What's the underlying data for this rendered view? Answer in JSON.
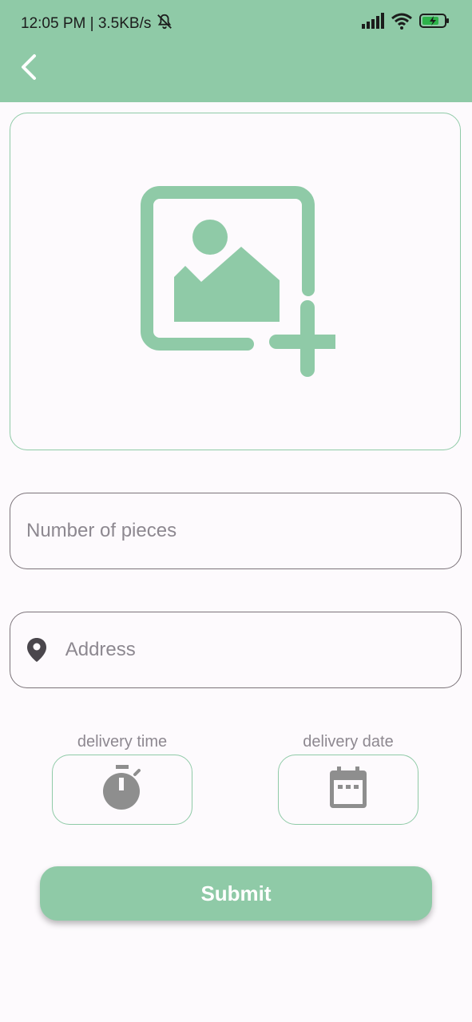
{
  "status_bar": {
    "time_speed": "12:05 PM | 3.5KB/s",
    "icons": [
      "bell-off-icon",
      "signal-icon",
      "wifi-icon",
      "battery-charging-icon"
    ]
  },
  "app_bar": {
    "back_icon": "chevron-left-icon",
    "color": "#8fcaa7"
  },
  "image_picker": {
    "icon": "add-image-icon"
  },
  "form": {
    "pieces": {
      "placeholder": "Number of pieces",
      "value": ""
    },
    "address": {
      "placeholder": "Address",
      "value": "",
      "icon": "location-pin-icon"
    },
    "delivery_time": {
      "label": "delivery time",
      "icon": "stopwatch-icon"
    },
    "delivery_date": {
      "label": "delivery date",
      "icon": "calendar-icon"
    }
  },
  "submit": {
    "label": "Submit"
  },
  "colors": {
    "accent": "#8fcaa7",
    "background": "#fdfafd",
    "outline": "#7b7379",
    "muted_text": "#8d8890"
  }
}
